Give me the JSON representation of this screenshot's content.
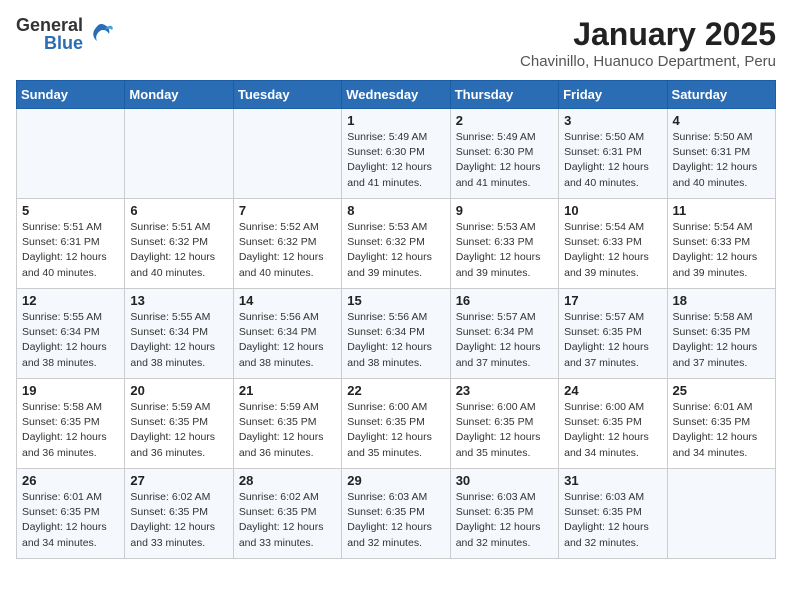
{
  "logo": {
    "general": "General",
    "blue": "Blue"
  },
  "title": "January 2025",
  "subtitle": "Chavinillo, Huanuco Department, Peru",
  "headers": [
    "Sunday",
    "Monday",
    "Tuesday",
    "Wednesday",
    "Thursday",
    "Friday",
    "Saturday"
  ],
  "weeks": [
    [
      {
        "day": "",
        "info": ""
      },
      {
        "day": "",
        "info": ""
      },
      {
        "day": "",
        "info": ""
      },
      {
        "day": "1",
        "info": "Sunrise: 5:49 AM\nSunset: 6:30 PM\nDaylight: 12 hours\nand 41 minutes."
      },
      {
        "day": "2",
        "info": "Sunrise: 5:49 AM\nSunset: 6:30 PM\nDaylight: 12 hours\nand 41 minutes."
      },
      {
        "day": "3",
        "info": "Sunrise: 5:50 AM\nSunset: 6:31 PM\nDaylight: 12 hours\nand 40 minutes."
      },
      {
        "day": "4",
        "info": "Sunrise: 5:50 AM\nSunset: 6:31 PM\nDaylight: 12 hours\nand 40 minutes."
      }
    ],
    [
      {
        "day": "5",
        "info": "Sunrise: 5:51 AM\nSunset: 6:31 PM\nDaylight: 12 hours\nand 40 minutes."
      },
      {
        "day": "6",
        "info": "Sunrise: 5:51 AM\nSunset: 6:32 PM\nDaylight: 12 hours\nand 40 minutes."
      },
      {
        "day": "7",
        "info": "Sunrise: 5:52 AM\nSunset: 6:32 PM\nDaylight: 12 hours\nand 40 minutes."
      },
      {
        "day": "8",
        "info": "Sunrise: 5:53 AM\nSunset: 6:32 PM\nDaylight: 12 hours\nand 39 minutes."
      },
      {
        "day": "9",
        "info": "Sunrise: 5:53 AM\nSunset: 6:33 PM\nDaylight: 12 hours\nand 39 minutes."
      },
      {
        "day": "10",
        "info": "Sunrise: 5:54 AM\nSunset: 6:33 PM\nDaylight: 12 hours\nand 39 minutes."
      },
      {
        "day": "11",
        "info": "Sunrise: 5:54 AM\nSunset: 6:33 PM\nDaylight: 12 hours\nand 39 minutes."
      }
    ],
    [
      {
        "day": "12",
        "info": "Sunrise: 5:55 AM\nSunset: 6:34 PM\nDaylight: 12 hours\nand 38 minutes."
      },
      {
        "day": "13",
        "info": "Sunrise: 5:55 AM\nSunset: 6:34 PM\nDaylight: 12 hours\nand 38 minutes."
      },
      {
        "day": "14",
        "info": "Sunrise: 5:56 AM\nSunset: 6:34 PM\nDaylight: 12 hours\nand 38 minutes."
      },
      {
        "day": "15",
        "info": "Sunrise: 5:56 AM\nSunset: 6:34 PM\nDaylight: 12 hours\nand 38 minutes."
      },
      {
        "day": "16",
        "info": "Sunrise: 5:57 AM\nSunset: 6:34 PM\nDaylight: 12 hours\nand 37 minutes."
      },
      {
        "day": "17",
        "info": "Sunrise: 5:57 AM\nSunset: 6:35 PM\nDaylight: 12 hours\nand 37 minutes."
      },
      {
        "day": "18",
        "info": "Sunrise: 5:58 AM\nSunset: 6:35 PM\nDaylight: 12 hours\nand 37 minutes."
      }
    ],
    [
      {
        "day": "19",
        "info": "Sunrise: 5:58 AM\nSunset: 6:35 PM\nDaylight: 12 hours\nand 36 minutes."
      },
      {
        "day": "20",
        "info": "Sunrise: 5:59 AM\nSunset: 6:35 PM\nDaylight: 12 hours\nand 36 minutes."
      },
      {
        "day": "21",
        "info": "Sunrise: 5:59 AM\nSunset: 6:35 PM\nDaylight: 12 hours\nand 36 minutes."
      },
      {
        "day": "22",
        "info": "Sunrise: 6:00 AM\nSunset: 6:35 PM\nDaylight: 12 hours\nand 35 minutes."
      },
      {
        "day": "23",
        "info": "Sunrise: 6:00 AM\nSunset: 6:35 PM\nDaylight: 12 hours\nand 35 minutes."
      },
      {
        "day": "24",
        "info": "Sunrise: 6:00 AM\nSunset: 6:35 PM\nDaylight: 12 hours\nand 34 minutes."
      },
      {
        "day": "25",
        "info": "Sunrise: 6:01 AM\nSunset: 6:35 PM\nDaylight: 12 hours\nand 34 minutes."
      }
    ],
    [
      {
        "day": "26",
        "info": "Sunrise: 6:01 AM\nSunset: 6:35 PM\nDaylight: 12 hours\nand 34 minutes."
      },
      {
        "day": "27",
        "info": "Sunrise: 6:02 AM\nSunset: 6:35 PM\nDaylight: 12 hours\nand 33 minutes."
      },
      {
        "day": "28",
        "info": "Sunrise: 6:02 AM\nSunset: 6:35 PM\nDaylight: 12 hours\nand 33 minutes."
      },
      {
        "day": "29",
        "info": "Sunrise: 6:03 AM\nSunset: 6:35 PM\nDaylight: 12 hours\nand 32 minutes."
      },
      {
        "day": "30",
        "info": "Sunrise: 6:03 AM\nSunset: 6:35 PM\nDaylight: 12 hours\nand 32 minutes."
      },
      {
        "day": "31",
        "info": "Sunrise: 6:03 AM\nSunset: 6:35 PM\nDaylight: 12 hours\nand 32 minutes."
      },
      {
        "day": "",
        "info": ""
      }
    ]
  ]
}
